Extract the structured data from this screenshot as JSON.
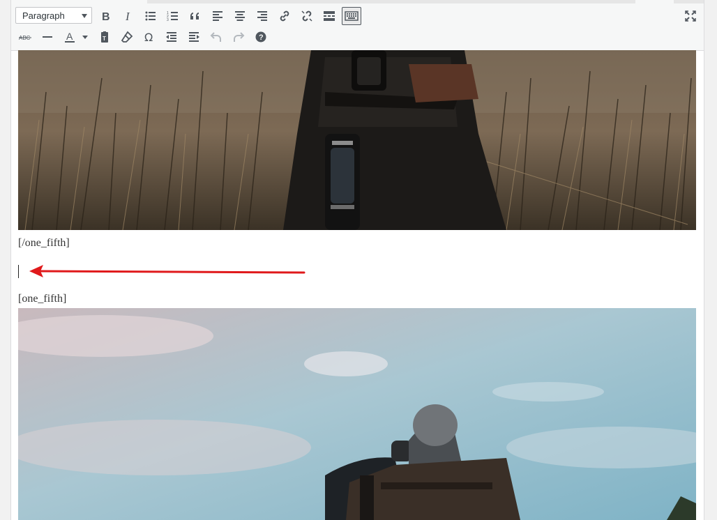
{
  "toolbar": {
    "format_select": "Paragraph",
    "row1": [
      {
        "name": "bold-button",
        "icon": "bold-icon"
      },
      {
        "name": "italic-button",
        "icon": "italic-icon"
      },
      {
        "name": "bulleted-list-button",
        "icon": "bulleted-list-icon"
      },
      {
        "name": "numbered-list-button",
        "icon": "numbered-list-icon"
      },
      {
        "name": "blockquote-button",
        "icon": "quote-icon"
      },
      {
        "name": "align-left-button",
        "icon": "align-left-icon"
      },
      {
        "name": "align-center-button",
        "icon": "align-center-icon"
      },
      {
        "name": "align-right-button",
        "icon": "align-right-icon"
      },
      {
        "name": "insert-link-button",
        "icon": "link-icon"
      },
      {
        "name": "remove-link-button",
        "icon": "unlink-icon"
      },
      {
        "name": "read-more-button",
        "icon": "read-more-icon"
      },
      {
        "name": "toolbar-toggle-button",
        "icon": "keyboard-icon",
        "active": true
      }
    ],
    "row2": [
      {
        "name": "strikethrough-button",
        "icon": "strikethrough-icon",
        "label": "ABC"
      },
      {
        "name": "horizontal-line-button",
        "icon": "horizontal-line-icon"
      },
      {
        "name": "text-color-button",
        "icon": "text-color-icon",
        "label": "A"
      },
      {
        "name": "paste-as-text-button",
        "icon": "paste-text-icon"
      },
      {
        "name": "clear-formatting-button",
        "icon": "eraser-icon"
      },
      {
        "name": "special-character-button",
        "icon": "omega-icon",
        "label": "Ω"
      },
      {
        "name": "decrease-indent-button",
        "icon": "outdent-icon"
      },
      {
        "name": "increase-indent-button",
        "icon": "indent-icon"
      },
      {
        "name": "undo-button",
        "icon": "undo-icon",
        "disabled": true
      },
      {
        "name": "redo-button",
        "icon": "redo-icon",
        "disabled": true
      },
      {
        "name": "keyboard-shortcuts-button",
        "icon": "help-icon",
        "label": "?"
      }
    ],
    "fullscreen_icon": "fullscreen-icon"
  },
  "content": {
    "shortcode_close": "[/one_fifth]",
    "shortcode_open": "[one_fifth]"
  },
  "colors": {
    "annotation_arrow": "#e0191b",
    "toolbar_bg": "#f6f7f7",
    "icon": "#50575e"
  }
}
